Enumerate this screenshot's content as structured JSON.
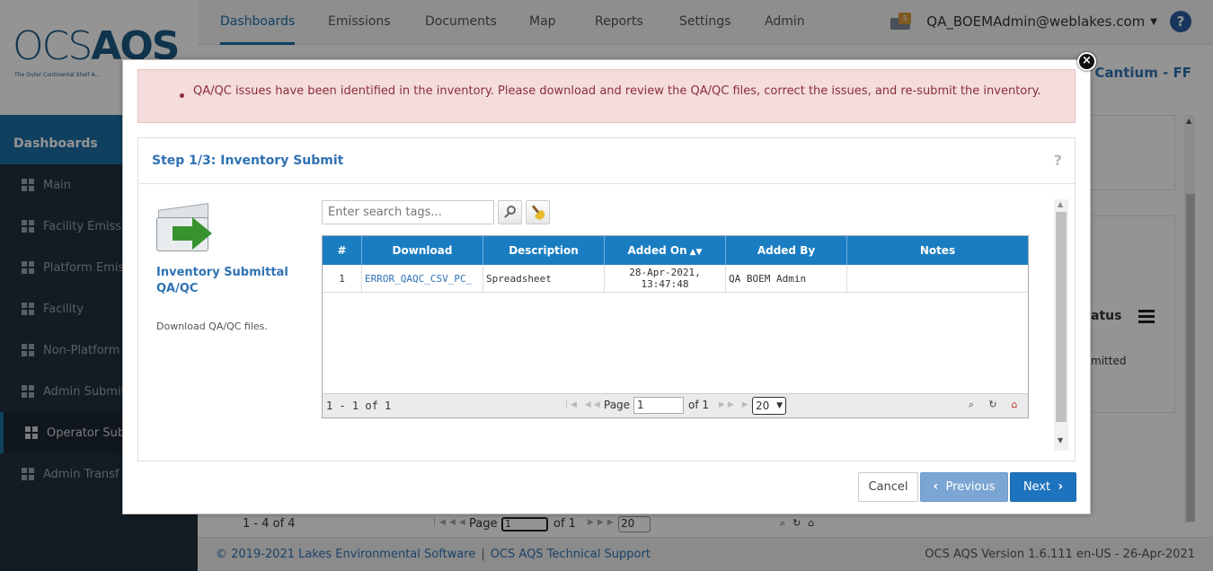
{
  "app": {
    "logo_ocs": "OCS",
    "logo_aqs": "AQS",
    "logo_tagline": "The Outer Continental Shelf A..."
  },
  "topnav": {
    "tabs": [
      "Dashboards",
      "Emissions",
      "Documents",
      "Map",
      "Reports",
      "Settings",
      "Admin"
    ],
    "active_tab": "Dashboards",
    "mail_count": "5",
    "user_email": "QA_BOEMAdmin@weblakes.com",
    "help_label": "?"
  },
  "sidebar": {
    "header": "Dashboards",
    "items": [
      {
        "label": "Main"
      },
      {
        "label": "Facility Emissi"
      },
      {
        "label": "Platform Emis"
      },
      {
        "label": "Facility"
      },
      {
        "label": "Non-Platform"
      },
      {
        "label": "Admin Submit"
      },
      {
        "label": "Operator Sub"
      },
      {
        "label": "Admin Transf"
      }
    ],
    "active_index": 6
  },
  "background": {
    "page_title": "ty - Cantium - FF",
    "status_label": "atus",
    "status_value": "mitted",
    "pager": {
      "count": "1 - 4 of 4",
      "page_label": "Page",
      "page_value": "1",
      "of_label": "of 1",
      "rows_value": "20"
    }
  },
  "footer": {
    "copyright": "© 2019-2021 Lakes Environmental Software",
    "support": "OCS AQS Technical Support",
    "version": "OCS AQS Version 1.6.111 en-US - 26-Apr-2021"
  },
  "modal": {
    "close_label": "×",
    "alert_message": "QA/QC issues have been identified in the inventory. Please download and review the QA/QC files, correct the issues, and re-submit the inventory.",
    "step_title": "Step 1/3: Inventory Submit",
    "help_label": "?",
    "section_title": "Inventory Submittal QA/QC",
    "section_desc": "Download QA/QC files.",
    "search_placeholder": "Enter search tags...",
    "grid": {
      "columns": [
        "#",
        "Download",
        "Description",
        "Added On",
        "Added By",
        "Notes"
      ],
      "rows": [
        {
          "num": "1",
          "download": "ERROR_QAQC_CSV_PC_",
          "description": "Spreadsheet",
          "added_on_date": "28-Apr-2021,",
          "added_on_time": "13:47:48",
          "added_by": "QA BOEM Admin",
          "notes": ""
        }
      ],
      "pager": {
        "count": "1 - 1 of 1",
        "page_label": "Page",
        "page_value": "1",
        "of_label": "of 1",
        "rows_value": "20"
      }
    },
    "buttons": {
      "cancel": "Cancel",
      "previous": "Previous",
      "next": "Next"
    }
  }
}
